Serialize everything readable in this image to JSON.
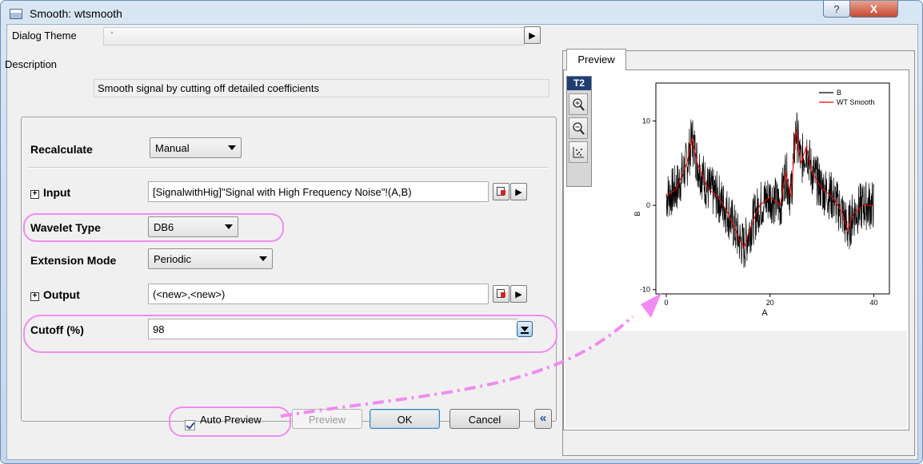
{
  "window": {
    "title": "Smooth: wtsmooth",
    "help_glyph": "?",
    "close_glyph": "X"
  },
  "dialog_theme": {
    "label": "Dialog Theme",
    "value": "*",
    "arrow": "▶"
  },
  "description": {
    "label": "Description",
    "text": "Smooth signal by cutting off detailed coefficients"
  },
  "settings": {
    "recalculate": {
      "label": "Recalculate",
      "value": "Manual"
    },
    "input": {
      "expand": "+",
      "label": "Input",
      "value": "[SignalwithHig]\"Signal with High Frequency Noise\"!(A,B)",
      "arrow": "▶"
    },
    "wavelet_type": {
      "label": "Wavelet Type",
      "value": "DB6"
    },
    "extension_mode": {
      "label": "Extension Mode",
      "value": "Periodic"
    },
    "output": {
      "expand": "+",
      "label": "Output",
      "value": "(<new>,<new>)",
      "arrow": "▶"
    },
    "cutoff": {
      "label": "Cutoff (%)",
      "value": "98"
    }
  },
  "footer": {
    "auto_preview_label": "Auto Preview",
    "auto_preview_checked": true,
    "preview_button": "Preview",
    "ok_button": "OK",
    "cancel_button": "Cancel",
    "collapse_glyph": "«"
  },
  "preview": {
    "tab_label": "Preview",
    "toolbar_badge": "T2",
    "zoom_in_icon": "zoom-in-icon",
    "zoom_out_icon": "zoom-out-icon",
    "rescale_icon": "rescale-icon"
  },
  "colors": {
    "highlight": "#f08cf0",
    "series_b": "#000000",
    "series_smooth": "#ff0000"
  },
  "chart_data": {
    "type": "line",
    "xlabel": "A",
    "ylabel": "B",
    "xlim": [
      -2,
      43
    ],
    "ylim": [
      -10.5,
      14.5
    ],
    "xticks": [
      0,
      20,
      40
    ],
    "yticks": [
      -10,
      0,
      10
    ],
    "legend_position": "top-right",
    "series": [
      {
        "name": "B",
        "x": [
          0,
          2,
          4,
          5,
          6,
          8,
          10,
          12,
          14,
          15,
          16,
          18,
          20,
          22,
          23,
          24,
          25,
          26,
          27,
          28,
          30,
          32,
          34,
          35,
          36,
          38,
          40
        ],
        "values": [
          1,
          2,
          5,
          8,
          5,
          2,
          1,
          -1,
          -4,
          -5,
          -3,
          0,
          1,
          0,
          4,
          1,
          9,
          5,
          7,
          4,
          2,
          1,
          -1,
          -3,
          -1,
          0,
          0
        ],
        "noise_amplitude": 3
      },
      {
        "name": "WT Smooth",
        "x": [
          0,
          2,
          4,
          5,
          6,
          8,
          10,
          12,
          14,
          15,
          16,
          18,
          20,
          22,
          23,
          24,
          25,
          26,
          27,
          28,
          30,
          32,
          34,
          35,
          36,
          38,
          40
        ],
        "values": [
          1,
          2,
          5,
          8,
          5,
          2,
          1,
          -1,
          -4,
          -5,
          -3,
          0,
          1,
          0,
          4,
          1,
          9,
          5,
          7,
          4,
          2,
          1,
          -1,
          -3,
          -1,
          0,
          0
        ]
      }
    ]
  }
}
